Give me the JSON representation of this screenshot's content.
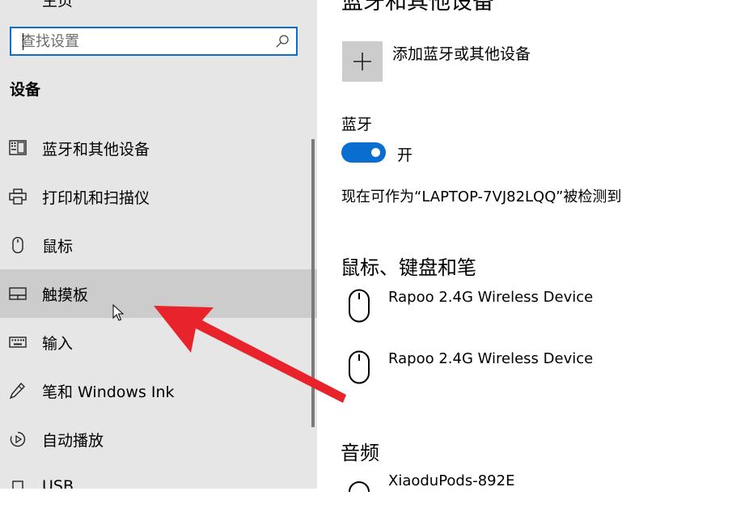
{
  "sidebar": {
    "top_label": "主页",
    "search": {
      "placeholder": "查找设置"
    },
    "section_title": "设备",
    "items": [
      {
        "label": "蓝牙和其他设备",
        "icon": "bluetooth-devices-icon"
      },
      {
        "label": "打印机和扫描仪",
        "icon": "printer-icon"
      },
      {
        "label": "鼠标",
        "icon": "mouse-icon"
      },
      {
        "label": "触摸板",
        "icon": "touchpad-icon",
        "selected": true
      },
      {
        "label": "输入",
        "icon": "keyboard-icon"
      },
      {
        "label": "笔和 Windows Ink",
        "icon": "pen-icon"
      },
      {
        "label": "自动播放",
        "icon": "autoplay-icon"
      },
      {
        "label": "USB",
        "icon": "usb-icon"
      }
    ]
  },
  "main": {
    "title": "蓝牙和其他设备",
    "add_device_label": "添加蓝牙或其他设备",
    "bluetooth": {
      "label": "蓝牙",
      "toggle_state": "开",
      "on": true,
      "discoverable_text": "现在可作为“LAPTOP-7VJ82LQQ”被检测到"
    },
    "mouse_section": {
      "title": "鼠标、键盘和笔",
      "devices": [
        {
          "name": "Rapoo 2.4G Wireless Device",
          "icon": "mouse-icon"
        },
        {
          "name": "Rapoo 2.4G Wireless Device",
          "icon": "mouse-icon"
        }
      ]
    },
    "audio_section": {
      "title": "音频",
      "devices": [
        {
          "name": "XiaoduPods-892E",
          "icon": "headphones-icon"
        }
      ]
    }
  },
  "colors": {
    "sidebar_bg": "#e6e6e6",
    "selected_bg": "#cccccc",
    "accent": "#0a6ed1",
    "annotation_arrow": "#e8232b"
  }
}
